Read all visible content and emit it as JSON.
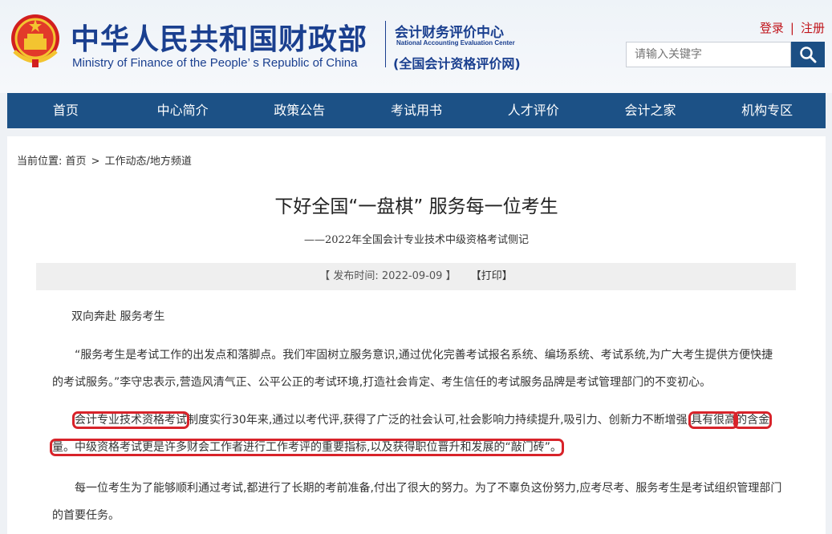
{
  "header": {
    "site_title_cn": "中华人民共和国财政部",
    "site_title_en": "Ministry of Finance of the People’ s Republic of China",
    "center_cn": "会计财务评价中心",
    "center_en": "National Accounting Evaluation Center",
    "center_sub": "(全国会计资格评价网)",
    "login": "登录",
    "register": "注册",
    "search_placeholder": "请输入关键字"
  },
  "nav": {
    "items": [
      "首页",
      "中心简介",
      "政策公告",
      "考试用书",
      "人才评价",
      "会计之家",
      "机构专区"
    ]
  },
  "breadcrumb": {
    "label": "当前位置:",
    "home": "首页",
    "arrow": ">",
    "section": "工作动态/地方频道"
  },
  "article": {
    "title": "下好全国“一盘棋” 服务每一位考生",
    "subtitle": "——2022年全国会计专业技术中级资格考试侧记",
    "meta_open": "【 发布时间:",
    "publish_date": "2022-09-09",
    "meta_close": "】",
    "print": "【打印】",
    "p1": "双向奔赴 服务考生",
    "p2": "“服务考生是考试工作的出发点和落脚点。我们牢固树立服务意识,通过优化完善考试报名系统、编场系统、考试系统,为广大考生提供方便快捷的考试服务。”李守忠表示,营造风清气正、公平公正的考试环境,打造社会肯定、考生信任的考试服务品牌是考试管理部门的不变初心。",
    "p3_hl1": "会计专业技术资格考试",
    "p3_mid": "制度实行30年来,通过以考代评,获得了广泛的社会认可,社会影响力持续提升,吸引力、创新力不断增强,",
    "p3_hl2a": "具有很高",
    "p3_hl2b": "的含金量。中级资格考试更是许多财会工作者进行工作考评的重要指标,以及获得职位晋升和发展的“敲门砖”。",
    "p4": "每一位考生为了能够顺利通过考试,都进行了长期的考前准备,付出了很大的努力。为了不辜负这份努力,应考尽考、服务考生是考试组织管理部门的首要任务。"
  },
  "colors": {
    "brand_blue": "#1a3f8f",
    "nav_blue": "#1c5186",
    "accent_red": "#c0141b",
    "highlight_red": "#d8232a"
  }
}
